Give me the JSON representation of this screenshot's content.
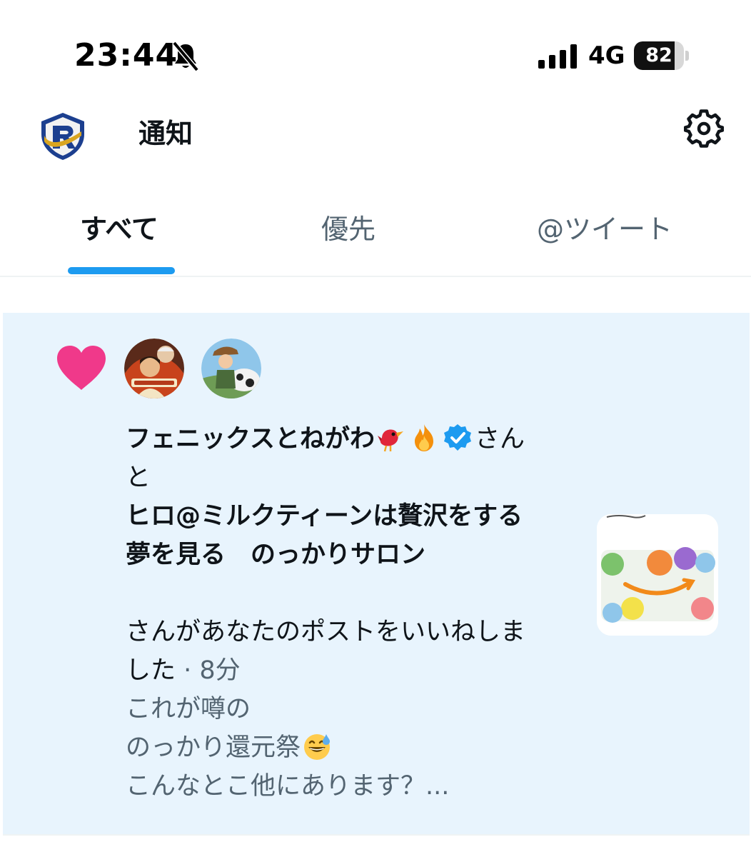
{
  "status_bar": {
    "time": "23:44",
    "network": "4G",
    "battery_level": "82",
    "battery_fraction": 0.82
  },
  "header": {
    "title": "通知",
    "logo_icon": "shield-r-logo",
    "settings_icon": "gear-icon"
  },
  "tabs": [
    {
      "label": "すべて",
      "active": true
    },
    {
      "label": "優先",
      "active": false
    },
    {
      "label": "@ツイート",
      "active": false
    }
  ],
  "colors": {
    "accent": "#1d9bf0",
    "heart": "#f0398a",
    "notification_bg": "#e8f4fd",
    "secondary_text": "#536471"
  },
  "notification": {
    "type_icon": "heart-icon",
    "user1_name": "フェニックスとねがわ",
    "user1_suffix": "さん",
    "connector": "と",
    "user2_name_line1": "ヒロ@ミルクティーンは贅沢をする",
    "user2_name_line2": "夢を見る　のっかりサロン",
    "action_line1": "さんがあなたのポストをいいねしま",
    "action_line2": "した",
    "time_sep": " · ",
    "time_ago": "8分",
    "post_line1": "これが噂の",
    "post_line2": "のっかり還元祭",
    "post_line3": "こんなとこ他にあります？..."
  }
}
